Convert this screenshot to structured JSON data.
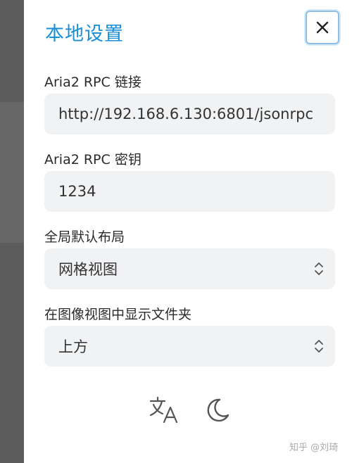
{
  "dialog": {
    "title": "本地设置"
  },
  "fields": {
    "rpc_url": {
      "label": "Aria2 RPC 链接",
      "value": "http://192.168.6.130:6801/jsonrpc"
    },
    "rpc_secret": {
      "label": "Aria2 RPC 密钥",
      "value": "1234"
    },
    "default_layout": {
      "label": "全局默认布局",
      "value": "网格视图"
    },
    "folder_position": {
      "label": "在图像视图中显示文件夹",
      "value": "上方"
    }
  },
  "icons": {
    "close": "close-icon",
    "translate": "translate-icon",
    "dark_mode": "moon-icon"
  },
  "watermark": "知乎 @刘琦",
  "colors": {
    "accent": "#1a8fd6",
    "input_bg": "#f1f2f4",
    "backdrop": "#5c5c5c"
  }
}
